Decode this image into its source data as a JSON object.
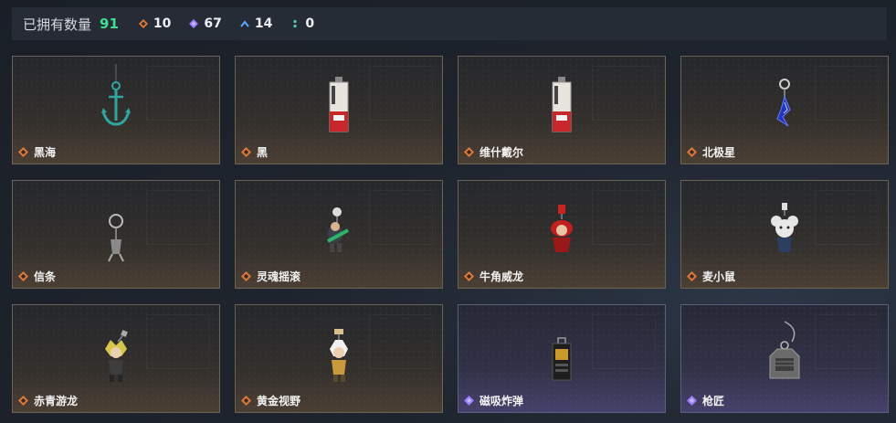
{
  "header": {
    "owned_label": "已拥有数量",
    "owned_value": "91",
    "stats": [
      {
        "icon": "orange-diamond-icon",
        "value": "10",
        "color": "#e07a36"
      },
      {
        "icon": "purple-diamond-icon",
        "value": "67",
        "color": "#9b7bff"
      },
      {
        "icon": "blue-chevron-icon",
        "value": "14",
        "color": "#5aa7ff"
      },
      {
        "icon": "teal-dots-icon",
        "value": "0",
        "color": "#4fd1b5"
      }
    ]
  },
  "colors": {
    "orange": "#e07a36",
    "purple": "#9b7bff",
    "owned_green": "#3ee08f"
  },
  "items": [
    {
      "name": "黑海",
      "rarity": "orange",
      "art": "anchor-charm"
    },
    {
      "name": "黑",
      "rarity": "orange",
      "art": "tag-charm-red"
    },
    {
      "name": "维什戴尔",
      "rarity": "orange",
      "art": "tag-charm-red"
    },
    {
      "name": "北极星",
      "rarity": "orange",
      "art": "blue-star-charm"
    },
    {
      "name": "信条",
      "rarity": "orange",
      "art": "ring-charm"
    },
    {
      "name": "灵魂摇滚",
      "rarity": "orange",
      "art": "guitar-figure-charm"
    },
    {
      "name": "牛角威龙",
      "rarity": "orange",
      "art": "red-figure-charm"
    },
    {
      "name": "麦小鼠",
      "rarity": "orange",
      "art": "mouse-figure-charm"
    },
    {
      "name": "赤青游龙",
      "rarity": "orange",
      "art": "yellow-figure-charm"
    },
    {
      "name": "黄金视野",
      "rarity": "orange",
      "art": "white-figure-charm"
    },
    {
      "name": "磁吸炸弹",
      "rarity": "purple",
      "art": "bomb-charm"
    },
    {
      "name": "枪匠",
      "rarity": "purple",
      "art": "tag-charm-grey"
    }
  ]
}
